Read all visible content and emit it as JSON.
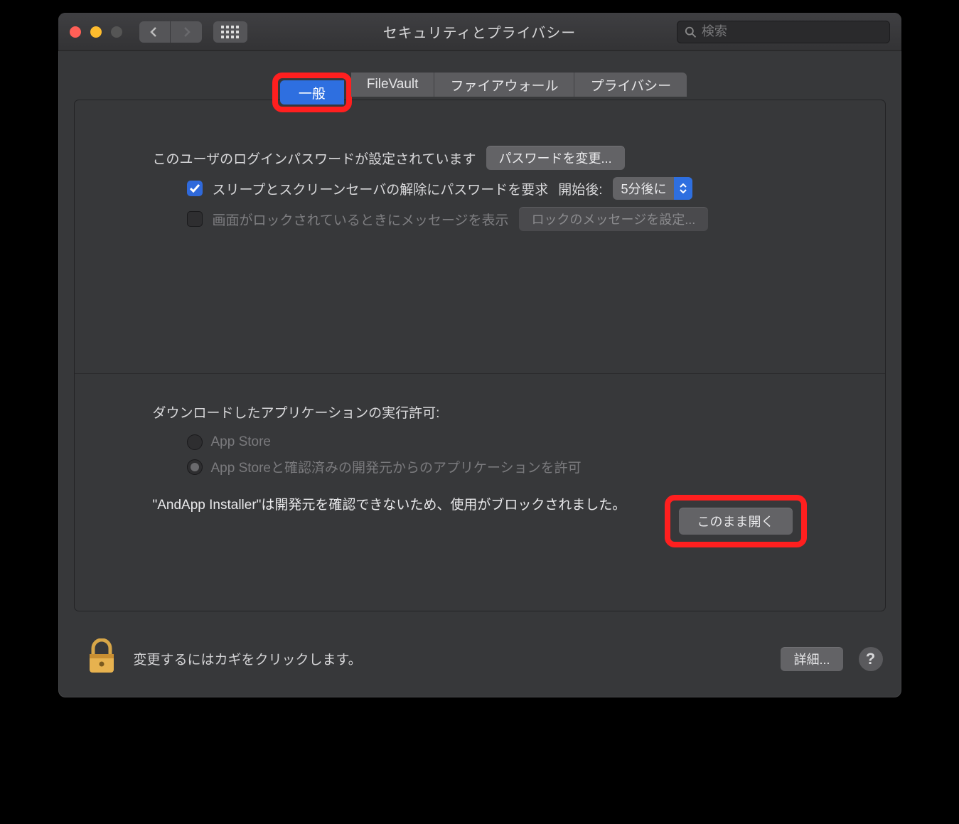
{
  "window": {
    "title": "セキュリティとプライバシー"
  },
  "search": {
    "placeholder": "検索"
  },
  "tabs": {
    "general": "一般",
    "filevault": "FileVault",
    "firewall": "ファイアウォール",
    "privacy": "プライバシー"
  },
  "general": {
    "password_set_label": "このユーザのログインパスワードが設定されています",
    "change_password_btn": "パスワードを変更...",
    "require_pw_label": "スリープとスクリーンセーバの解除にパスワードを要求",
    "after_label": "開始後:",
    "after_value": "5分後に",
    "lock_msg_label": "画面がロックされているときにメッセージを表示",
    "set_lock_msg_btn": "ロックのメッセージを設定..."
  },
  "download": {
    "section_title": "ダウンロードしたアプリケーションの実行許可:",
    "opt_appstore": "App Store",
    "opt_identified": "App Storeと確認済みの開発元からのアプリケーションを許可",
    "blocked_msg": "\"AndApp Installer\"は開発元を確認できないため、使用がブロックされました。",
    "open_anyway_btn": "このまま開く"
  },
  "footer": {
    "lock_text": "変更するにはカギをクリックします。",
    "advanced_btn": "詳細..."
  }
}
